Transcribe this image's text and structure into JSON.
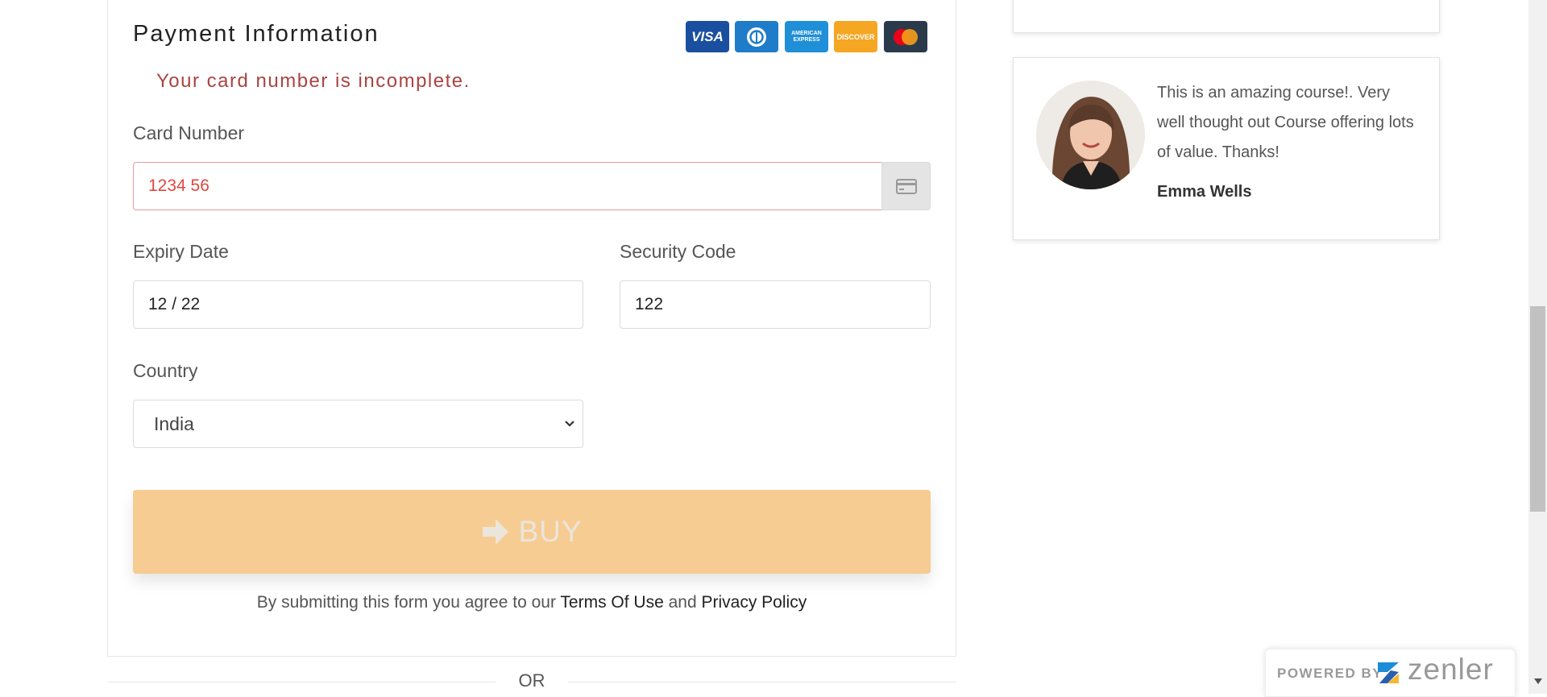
{
  "payment": {
    "title": "Payment Information",
    "error_message": "Your card number is incomplete.",
    "card_logos": [
      "VISA",
      "Diners Club",
      "AMERICAN EXPRESS",
      "DISCOVER",
      "Mastercard"
    ],
    "card_number": {
      "label": "Card Number",
      "value": "1234 56"
    },
    "expiry": {
      "label": "Expiry Date",
      "value": "12 / 22"
    },
    "security": {
      "label": "Security Code",
      "value": "122"
    },
    "country": {
      "label": "Country",
      "selected": "India"
    },
    "buy_label": "BUY",
    "terms": {
      "prefix": "By submitting this form you agree to our ",
      "terms_link": "Terms Of Use",
      "and": " and ",
      "privacy_link": "Privacy Policy"
    },
    "or_divider": "OR"
  },
  "testimonial": {
    "quote": "This is an amazing course!. Very well thought out Course offering lots of value. Thanks!",
    "author": "Emma Wells"
  },
  "badge": {
    "powered_by": "POWERED BY",
    "brand": "zenler"
  },
  "colors": {
    "error_text": "#a94442",
    "error_border": "#e89aa0",
    "buy_button": "#f6cc92",
    "visa": "#1a4fa0",
    "diners": "#1e7cc8",
    "amex": "#1f8fd8",
    "discover": "#f5a623",
    "mastercard": "#2b3a4a"
  }
}
